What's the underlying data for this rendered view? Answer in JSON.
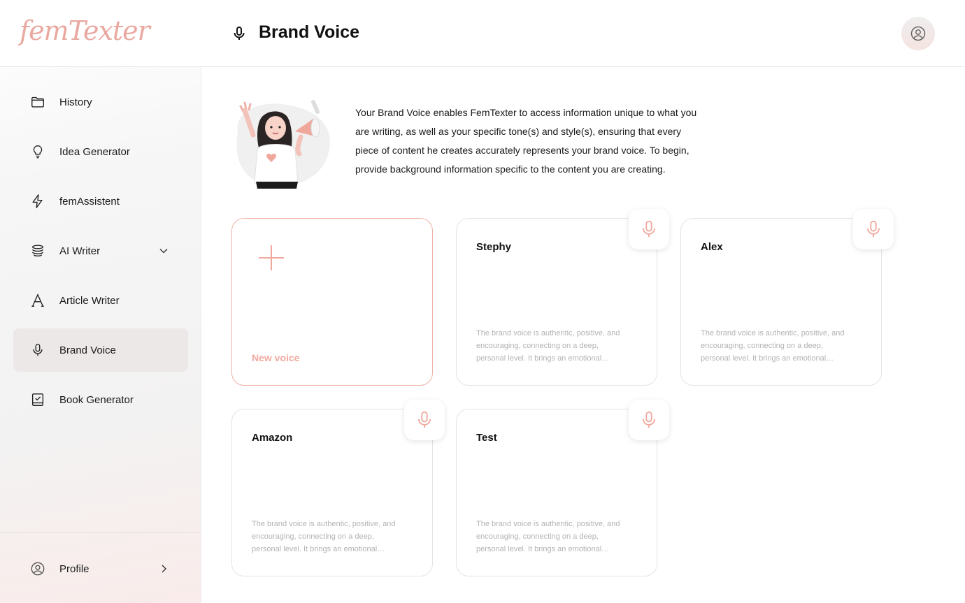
{
  "app": {
    "logo": "femTexter"
  },
  "sidebar": {
    "items": [
      {
        "label": "History",
        "icon": "folder-icon",
        "active": false
      },
      {
        "label": "Idea Generator",
        "icon": "lightbulb-icon",
        "active": false
      },
      {
        "label": "femAssistent",
        "icon": "lightning-icon",
        "active": false
      },
      {
        "label": "AI Writer",
        "icon": "layers-icon",
        "active": false,
        "expandable": true
      },
      {
        "label": "Article Writer",
        "icon": "letter-a-icon",
        "active": false
      },
      {
        "label": "Brand Voice",
        "icon": "microphone-icon",
        "active": true
      },
      {
        "label": "Book Generator",
        "icon": "book-icon",
        "active": false
      }
    ],
    "profile_label": "Profile"
  },
  "header": {
    "title": "Brand Voice",
    "icon": "microphone-icon"
  },
  "intro": {
    "text": "Your Brand Voice enables FemTexter to access information unique to what you are writing, as well as your specific tone(s) and style(s), ensuring that every piece of content he creates accurately represents your brand voice. To begin, provide background information specific to the content you are creating."
  },
  "new_voice": {
    "label": "New voice"
  },
  "voices": [
    {
      "name": "Stephy",
      "description": "The brand voice is authentic, positive, and encouraging, connecting on a deep, personal level. It brings an emotional resonance to every message."
    },
    {
      "name": "Alex",
      "description": "The brand voice is authentic, positive, and encouraging, connecting on a deep, personal level. It brings an emotional resonance to every message."
    },
    {
      "name": "Amazon",
      "description": "The brand voice is authentic, positive, and encouraging, connecting on a deep, personal level. It brings an emotional resonance to every message."
    },
    {
      "name": "Test",
      "description": "The brand voice is authentic, positive, and encouraging, connecting on a deep, personal level. It brings an emotional resonance to every message."
    }
  ],
  "colors": {
    "accent": "#f1a99f",
    "active_bg": "#ede8e8",
    "muted_text": "#b3b3b3"
  }
}
